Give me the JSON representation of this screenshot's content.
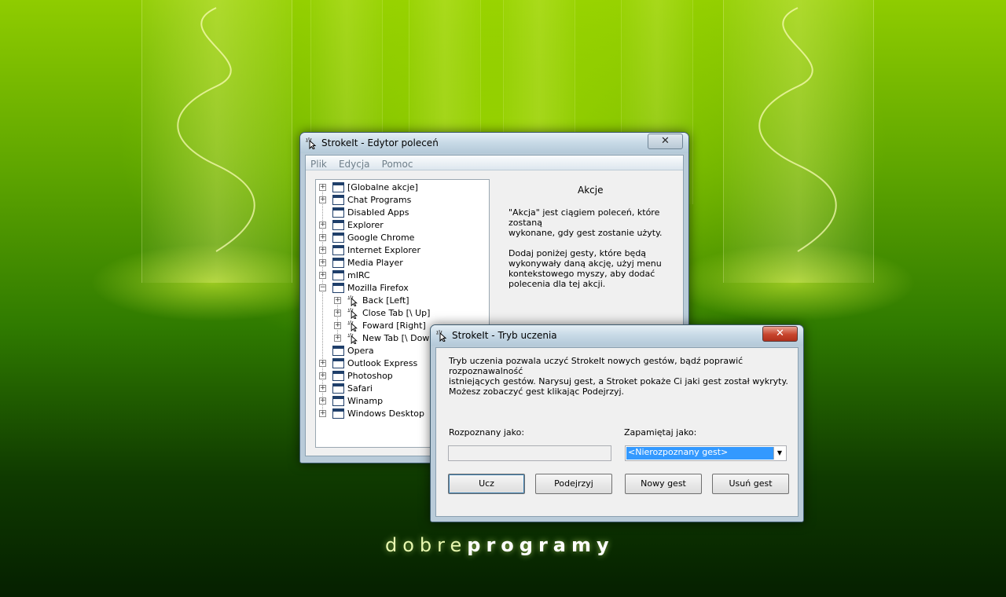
{
  "desktop": {
    "logo_light": "dobre",
    "logo_bold": "programy"
  },
  "editor_window": {
    "title": "StrokeIt - Edytor poleceń",
    "close_glyph": "✕",
    "menu": [
      "Plik",
      "Edycja",
      "Pomoc"
    ],
    "tree": [
      {
        "label": "[Globalne akcje]",
        "icon": "folder-icon",
        "expandable": true,
        "level": 0
      },
      {
        "label": "Chat Programs",
        "icon": "folder-icon",
        "expandable": true,
        "level": 0
      },
      {
        "label": "Disabled Apps",
        "icon": "folder-icon",
        "expandable": false,
        "level": 0
      },
      {
        "label": "Explorer",
        "icon": "folder-icon",
        "expandable": true,
        "level": 0
      },
      {
        "label": "Google Chrome",
        "icon": "folder-icon",
        "expandable": true,
        "level": 0
      },
      {
        "label": "Internet Explorer",
        "icon": "folder-icon",
        "expandable": true,
        "level": 0
      },
      {
        "label": "Media Player",
        "icon": "folder-icon",
        "expandable": true,
        "level": 0
      },
      {
        "label": "mIRC",
        "icon": "folder-icon",
        "expandable": true,
        "level": 0
      },
      {
        "label": "Mozilla Firefox",
        "icon": "folder-icon",
        "expandable": true,
        "expanded": true,
        "level": 0
      },
      {
        "label": "Back [Left]",
        "icon": "gesture-cursor-icon",
        "expandable": true,
        "level": 1
      },
      {
        "label": "Close Tab [\\ Up]",
        "icon": "gesture-cursor-icon",
        "expandable": true,
        "level": 1
      },
      {
        "label": "Foward [Right]",
        "icon": "gesture-cursor-icon",
        "expandable": true,
        "level": 1
      },
      {
        "label": "New Tab [\\ Down]",
        "icon": "gesture-cursor-icon",
        "expandable": true,
        "level": 1
      },
      {
        "label": "Opera",
        "icon": "folder-icon",
        "expandable": false,
        "level": 0
      },
      {
        "label": "Outlook Express",
        "icon": "folder-icon",
        "expandable": true,
        "level": 0
      },
      {
        "label": "Photoshop",
        "icon": "folder-icon",
        "expandable": true,
        "level": 0
      },
      {
        "label": "Safari",
        "icon": "folder-icon",
        "expandable": true,
        "level": 0
      },
      {
        "label": "Winamp",
        "icon": "folder-icon",
        "expandable": true,
        "level": 0
      },
      {
        "label": "Windows Desktop",
        "icon": "folder-icon",
        "expandable": true,
        "level": 0
      }
    ],
    "panel_heading": "Akcje",
    "panel_para1_line1": "\"Akcja\" jest ciągiem poleceń, które zostaną",
    "panel_para1_line2": "wykonane, gdy gest zostanie użyty.",
    "panel_para2_line1": "Dodaj poniżej gesty, które będą",
    "panel_para2_line2": "wykonywały daną akcję, użyj menu",
    "panel_para2_line3": "kontekstowego myszy, aby dodać",
    "panel_para2_line4": "polecenia dla tej akcji."
  },
  "learn_window": {
    "title": "StrokeIt - Tryb uczenia",
    "close_glyph": "✕",
    "intro_line1": "Tryb uczenia pozwala uczyć StrokeIt nowych gestów, bądź poprawić rozpoznawalność",
    "intro_line2": "istniejących gestów.  Narysuj gest, a Stroket pokaże Ci jaki gest został wykryty.",
    "hint": "Możesz zobaczyć gest klikając Podejrzyj.",
    "recognized_label": "Rozpoznany jako:",
    "recognized_value": "",
    "remember_label": "Zapamiętaj jako:",
    "remember_selected": "<Nierozpoznany gest>",
    "buttons": {
      "learn": "Ucz",
      "preview": "Podejrzyj",
      "new_gesture": "Nowy gest",
      "delete_gesture": "Usuń gest"
    }
  },
  "colors": {
    "desktop_green": "#5fa600",
    "window_frame": "#b9cbd9",
    "close_red": "#c7442c",
    "selection_blue": "#3399ff"
  }
}
